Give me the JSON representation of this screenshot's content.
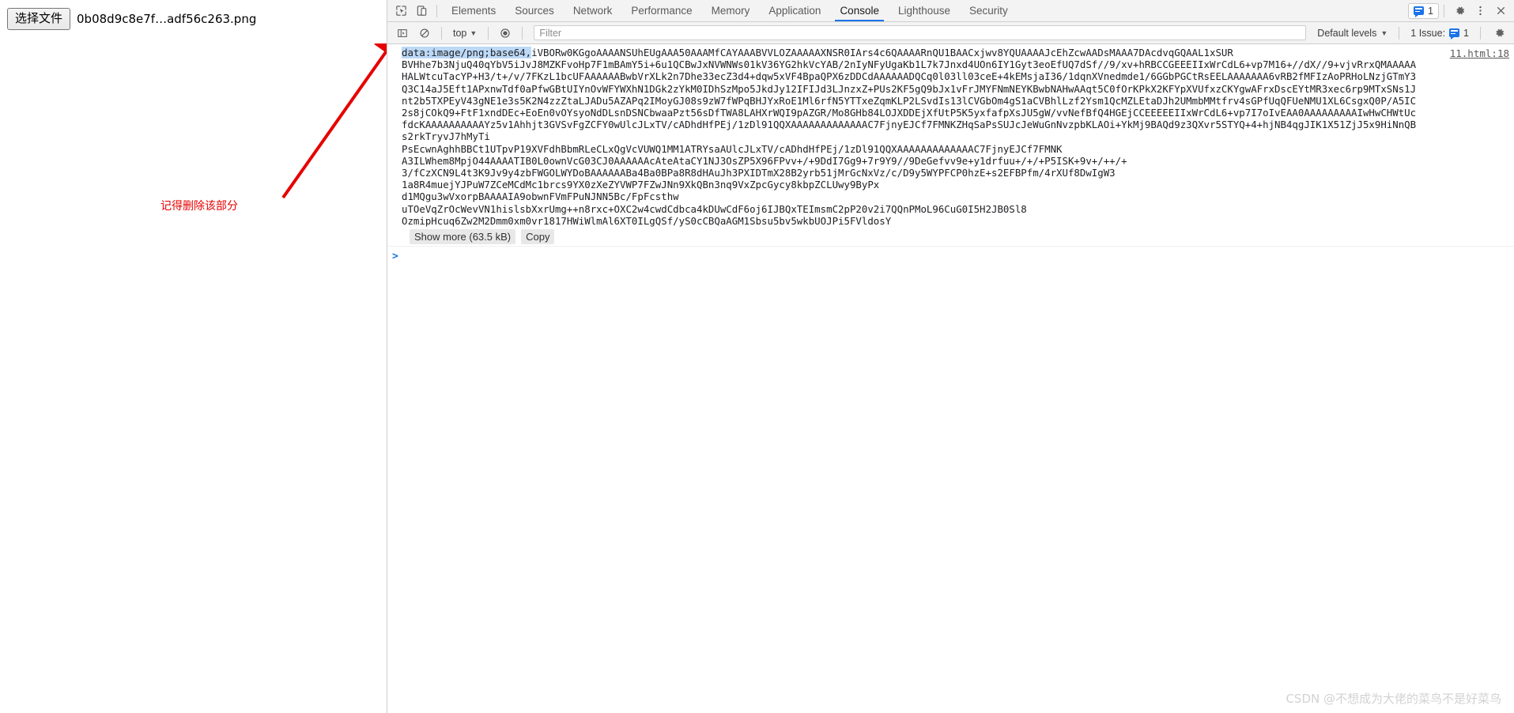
{
  "page": {
    "file_input": {
      "button_label": "选择文件",
      "file_name": "0b08d9c8e7f…adf56c263.png"
    },
    "annotation": {
      "note_text": "记得删除该部分",
      "note_color": "#e60000",
      "arrow_color": "#e60000"
    }
  },
  "devtools": {
    "toolbar": {
      "inspect_icon": "inspect-element-icon",
      "device_toolbar_icon": "device-toolbar-icon",
      "tabs": [
        {
          "label": "Elements",
          "active": false
        },
        {
          "label": "Sources",
          "active": false
        },
        {
          "label": "Network",
          "active": false
        },
        {
          "label": "Performance",
          "active": false
        },
        {
          "label": "Memory",
          "active": false
        },
        {
          "label": "Application",
          "active": false
        },
        {
          "label": "Console",
          "active": true
        },
        {
          "label": "Lighthouse",
          "active": false
        },
        {
          "label": "Security",
          "active": false
        }
      ],
      "issue_count": "1",
      "settings_icon": "gear-icon",
      "more_icon": "kebab-menu-icon",
      "close_icon": "close-icon",
      "accent_color": "#1a73e8"
    },
    "console_toolbar": {
      "sidebar_toggle_icon": "console-sidebar-icon",
      "clear_icon": "clear-console-icon",
      "context_value": "top",
      "eye_icon": "live-expression-icon",
      "filter_placeholder": "Filter",
      "filter_value": "",
      "levels_value": "Default levels",
      "issues_label": "1 Issue:",
      "issues_count": "1",
      "settings_icon": "gear-icon"
    },
    "console": {
      "message": {
        "source_link": "11.html:18",
        "selected_prefix": "data:image/png;base64,",
        "body": "iVBORw0KGgoAAAANSUhEUgAAA50AAAMfCAYAAABVVLOZAAAAAXNSR0IArs4c6QAAAARnQU1BAACxjwv8YQUAAAAJcEhZcwAADsMAAA7DAcdvqGQAAL1xSUR\nBVHhe7b3NjuQ40qYbV5iJvJ8MZKFvoHp7F1mBAmY5i+6u1QCBwJxNVWNWs01kV36YG2hkVcYAB/2nIyNFyUgaKb1L7k7Jnxd4UOn6IY1Gyt3eoEfUQ7dSf//9/xv+hRBCCGEEEIIxWrCdL6+vp7M16+//dX//9+vjvRrxQMAAAAAHALWtcuTacYP+H3/t+/v/7FKzL1bcUFAAAAAABwbVrXLk2n7Dhe33ecZ3d4+dqw5xVF4BpaQPX6zDDCdAAAAAADQCq0l03ll03ceE+4kEMsjaI36/1dqnXVnedmde1/6GGbPGCtRsEELAAAAAAA6vRB2fMFIzAoPRHoLNzjGTmY3Q3C14aJ5Eft1APxnwTdf0aPfwGBtUIYnOvWFYWXhN1DGk2zYkM0IDhSzMpo5JkdJy12IFIJd3LJnzxZ+PUs2KF5gQ9bJx1vFrJMYFNmNEYKBwbNAHwAAqt5C0fOrKPkX2KFYpXVUfxzCKYgwAFrxDscEYtMR3xec6rp9MTxSNs1Jnt2b5TXPEyV43gNE1e3s5K2N4zzZtaLJADu5AZAPq2IMoyGJ08s9zW7fWPqBHJYxRoE1Ml6rfN5YTTxeZqmKLP2LSvdIs13lCVGbOm4gS1aCVBhlLzf2Ysm1QcMZLEtaDJh2UMmbMMtfrv4sGPfUqQFUeNMU1XL6CsgxQ0P/A5IC2s8jCOkQ9+FtF1xndDEc+EoEn0vOYsyoNdDLsnDSNCbwaaPzt56sDfTWA8LAHXrWQI9pAZGR/Mo8GHb84LOJXDDEjXfUtP5K5yxfafpXsJU5gW/vvNefBfQ4HGEjCCEEEEEIIxWrCdL6+vp7I7oIvEAA0AAAAAAAAAIwHwCHWtUcfdcKAAAAAAAAAAYz5v1Ahhjt3GVSvFgZCFY0wUlcJLxTV/cADhdHfPEj/1zDl91QQXAAAAAAAAAAAAAC7FjnyEJCf7FMNKZHqSaPsSUJcJeWuGnNvzpbKLAOi+YkMj9BAQd9z3QXvr5STYQ+4+hjNB4qgJIK1X51ZjJ5x9HiNnQBs2rkTryvJ7hMyTi\nPsEcwnAghhBBCt1UTpvP19XVFdhBbmRLeCLxQgVcVUWQ1MM1ATRYsaAUlcJLxTV/cADhdHfPEj/1zDl91QQXAAAAAAAAAAAAAC7FjnyEJCf7FMNK\nA3ILWhem8MpjO44AAAATIB0L0ownVcG03CJ0AAAAAAcAteAtaCY1NJ3OsZP5X96FPvv+/+9DdI7Gg9+7r9Y9//9DeGefvv9e+y1drfuu+/+/+P5ISK+9v+/++/+\n3/fCzXCN9L4t3K9Jv9y4zbFWGOLWYDoBAAAAAABa4Ba0BPa8R8dHAuJh3PXIDTmX28B2yrb51jMrGcNxVz/c/D9y5WYPFCP0hzE+s2EFBPfm/4rXUf8DwIgW3\n1a8R4muejYJPuW7ZCeMCdMc1brcs9YX0zXeZYVWP7FZwJNn9XkQBn3nq9VxZpcGycy8kbpZCLUwy9ByPx\nd1MQgu3wVxorpBAAAAIA9obwnFVmFPuNJNN5Bc/FpFcsthw\nuTOeVqZrOcWevVN1hislsbXxrUmg++n8rxc+OXC2w4cwdCdbca4kDUwCdF6oj6IJBQxTEImsmC2pP20v2i7QQnPMoL96CuG0I5H2JB0Sl8\nOzmipHcuq6Zw2M2Dmm0xm0vr1817HWiWlmAl6XT0ILgQSf/yS0cCBQaAGM1Sbsu5bv5wkbUOJPi5FVldosY",
        "show_more_label": "Show more (63.5 kB)",
        "copy_label": "Copy"
      },
      "prompt": {
        "caret": ">",
        "value": ""
      }
    }
  },
  "watermark": "CSDN @不想成为大佬的菜鸟不是好菜鸟"
}
